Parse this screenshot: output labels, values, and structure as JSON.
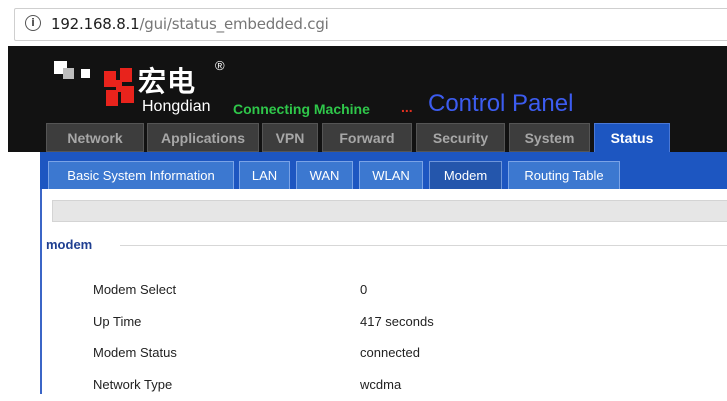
{
  "browser": {
    "url_host": "192.168.8.1",
    "url_path": "/gui/status_embedded.cgi"
  },
  "header": {
    "logo_cn": "宏电",
    "logo_reg": "®",
    "logo_en": "Hongdian",
    "tagline": "Connecting Machine",
    "tagline_dots": "...",
    "title": "Control Panel"
  },
  "main_tabs": [
    {
      "label": "Network"
    },
    {
      "label": "Applications"
    },
    {
      "label": "VPN"
    },
    {
      "label": "Forward"
    },
    {
      "label": "Security"
    },
    {
      "label": "System"
    },
    {
      "label": "Status",
      "active": true
    }
  ],
  "sub_tabs": [
    {
      "label": "Basic System Information"
    },
    {
      "label": "LAN"
    },
    {
      "label": "WAN"
    },
    {
      "label": "WLAN"
    },
    {
      "label": "Modem",
      "active": true
    },
    {
      "label": "Routing Table"
    }
  ],
  "section": {
    "legend": "modem",
    "rows": [
      {
        "label": "Modem Select",
        "value": "0"
      },
      {
        "label": "Up Time",
        "value": "417 seconds"
      },
      {
        "label": "Modem Status",
        "value": "connected"
      },
      {
        "label": "Network Type",
        "value": "wcdma"
      }
    ]
  },
  "colors": {
    "active_tab": "#1d56c1",
    "tagline": "#2fc74a",
    "title": "#3c5cf0",
    "logo_red": "#e8231c"
  }
}
